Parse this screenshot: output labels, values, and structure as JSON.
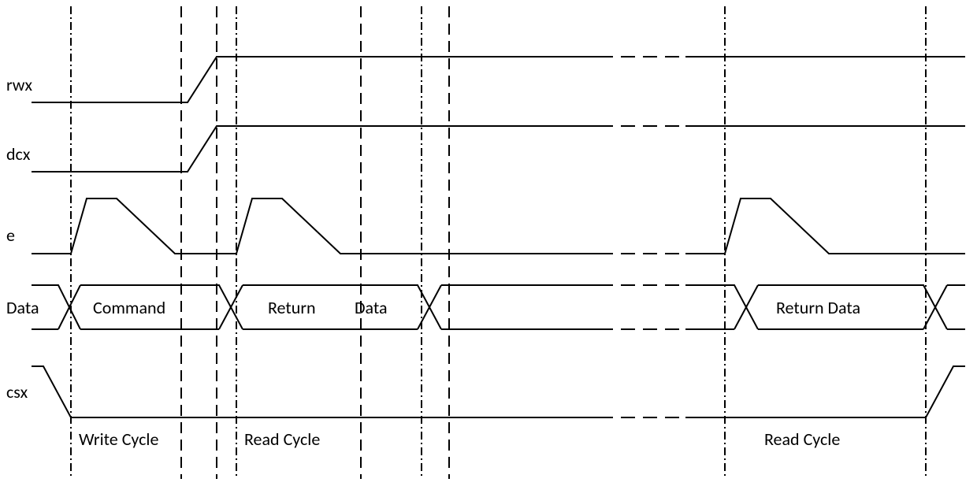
{
  "signals": {
    "rwx": "rwx",
    "dcx": "dcx",
    "e": "e",
    "data": "Data",
    "csx": "csx"
  },
  "bus_labels": {
    "command": "Command",
    "return_data1": "Return",
    "return_data1b": "Data",
    "return_data2": "Return Data"
  },
  "cycles": {
    "write": "Write Cycle",
    "read1": "Read Cycle",
    "read2": "Read Cycle"
  }
}
